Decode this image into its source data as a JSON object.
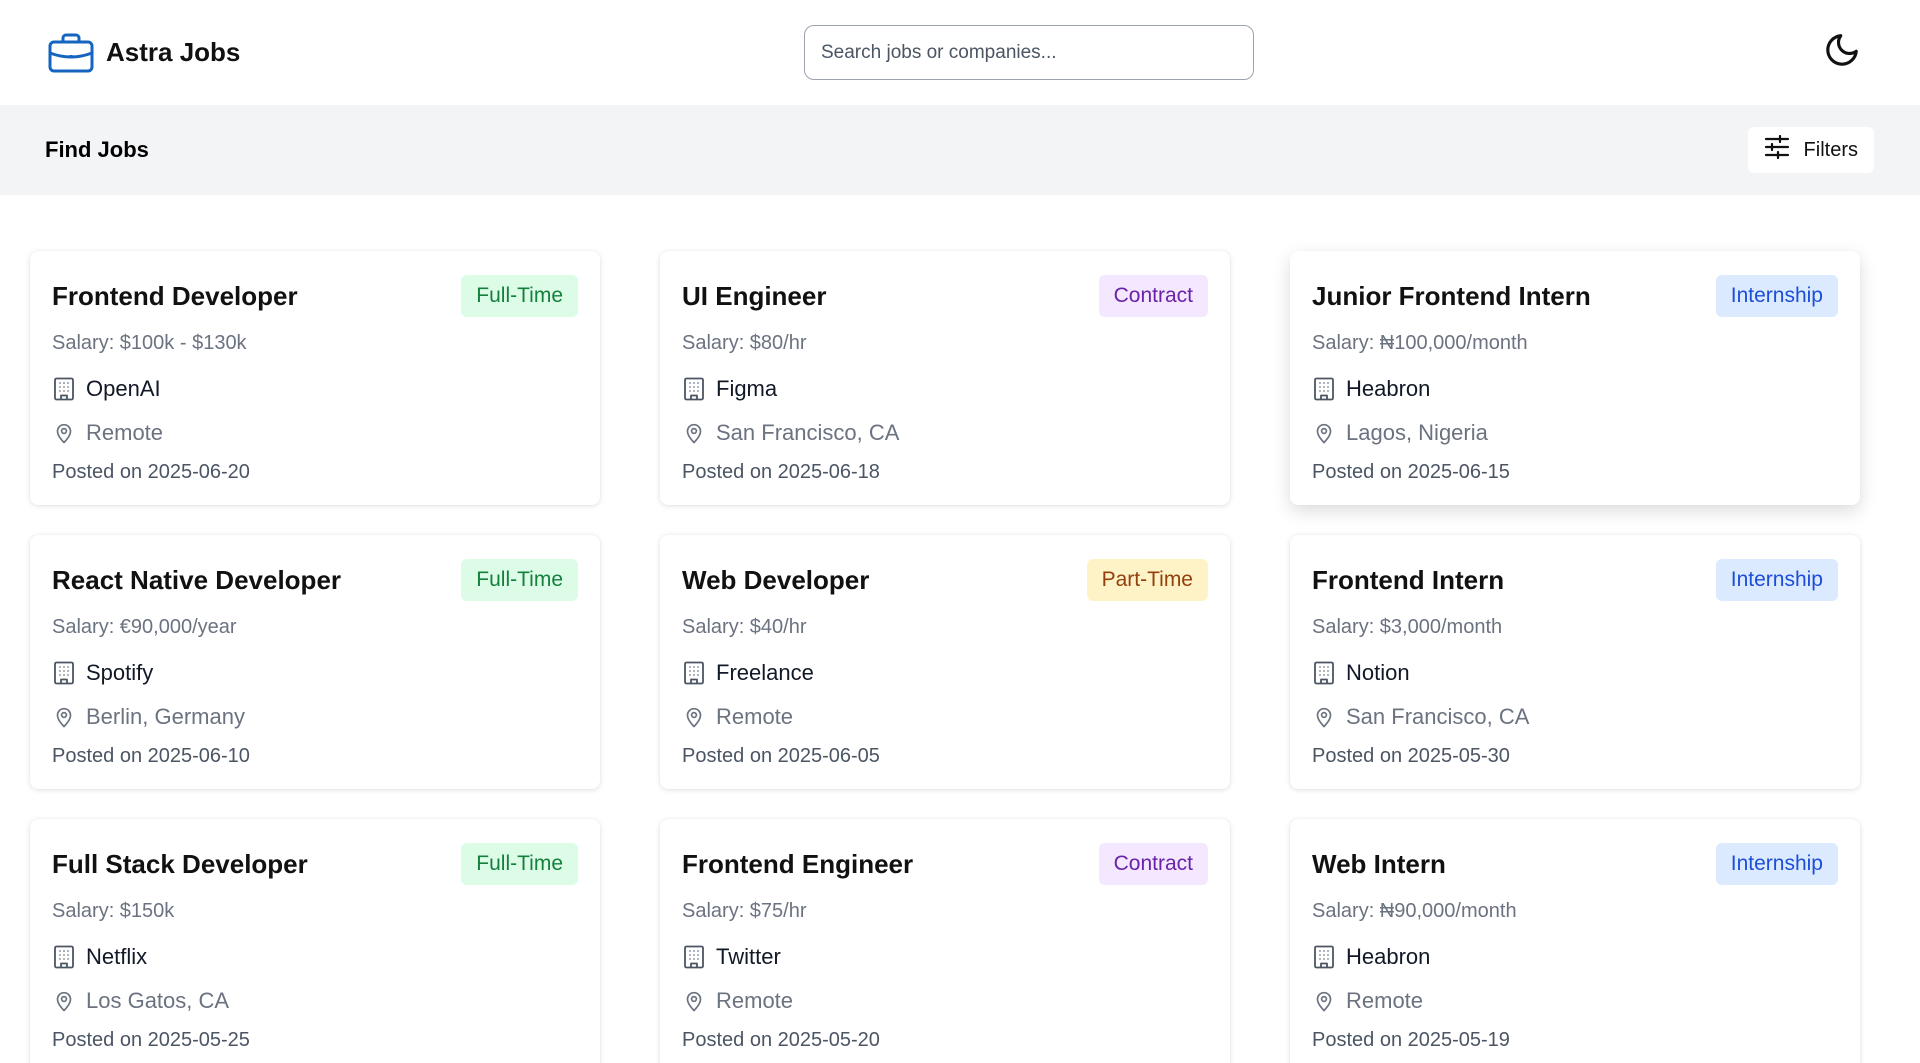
{
  "app": {
    "name": "Astra Jobs",
    "logo_icon": "briefcase-icon",
    "accent": "#1565c0"
  },
  "search": {
    "placeholder": "Search jobs or companies...",
    "value": ""
  },
  "theme_toggle": {
    "icon": "moon-icon"
  },
  "subheader": {
    "title": "Find Jobs",
    "filters_label": "Filters",
    "filters_icon": "sliders-icon"
  },
  "labels": {
    "salary_prefix": "Salary: ",
    "posted_prefix": "Posted on "
  },
  "jobs": [
    {
      "title": "Frontend Developer",
      "type": "Full-Time",
      "salary": "Salary: $100k - $130k",
      "company": "OpenAI",
      "location": "Remote",
      "posted": "Posted on 2025-06-20"
    },
    {
      "title": "UI Engineer",
      "type": "Contract",
      "salary": "Salary: $80/hr",
      "company": "Figma",
      "location": "San Francisco, CA",
      "posted": "Posted on 2025-06-18"
    },
    {
      "title": "Junior Frontend Intern",
      "type": "Internship",
      "salary": "Salary: ₦100,000/month",
      "company": "Heabron",
      "location": "Lagos, Nigeria",
      "posted": "Posted on 2025-06-15"
    },
    {
      "title": "React Native Developer",
      "type": "Full-Time",
      "salary": "Salary: €90,000/year",
      "company": "Spotify",
      "location": "Berlin, Germany",
      "posted": "Posted on 2025-06-10"
    },
    {
      "title": "Web Developer",
      "type": "Part-Time",
      "salary": "Salary: $40/hr",
      "company": "Freelance",
      "location": "Remote",
      "posted": "Posted on 2025-06-05"
    },
    {
      "title": "Frontend Intern",
      "type": "Internship",
      "salary": "Salary: $3,000/month",
      "company": "Notion",
      "location": "San Francisco, CA",
      "posted": "Posted on 2025-05-30"
    },
    {
      "title": "Full Stack Developer",
      "type": "Full-Time",
      "salary": "Salary: $150k",
      "company": "Netflix",
      "location": "Los Gatos, CA",
      "posted": "Posted on 2025-05-25"
    },
    {
      "title": "Frontend Engineer",
      "type": "Contract",
      "salary": "Salary: $75/hr",
      "company": "Twitter",
      "location": "Remote",
      "posted": "Posted on 2025-05-20"
    },
    {
      "title": "Web Intern",
      "type": "Internship",
      "salary": "Salary: ₦90,000/month",
      "company": "Heabron",
      "location": "Remote",
      "posted": "Posted on 2025-05-19"
    }
  ],
  "badge_colors": {
    "Full-Time": {
      "bg": "#dcfce7",
      "fg": "#15803d"
    },
    "Contract": {
      "bg": "#f3e8ff",
      "fg": "#6b21a8"
    },
    "Internship": {
      "bg": "#dbeafe",
      "fg": "#1d4ed8"
    },
    "Part-Time": {
      "bg": "#fef3c7",
      "fg": "#92400e"
    }
  },
  "card_icons": {
    "company": "building-icon",
    "location": "map-pin-icon"
  }
}
